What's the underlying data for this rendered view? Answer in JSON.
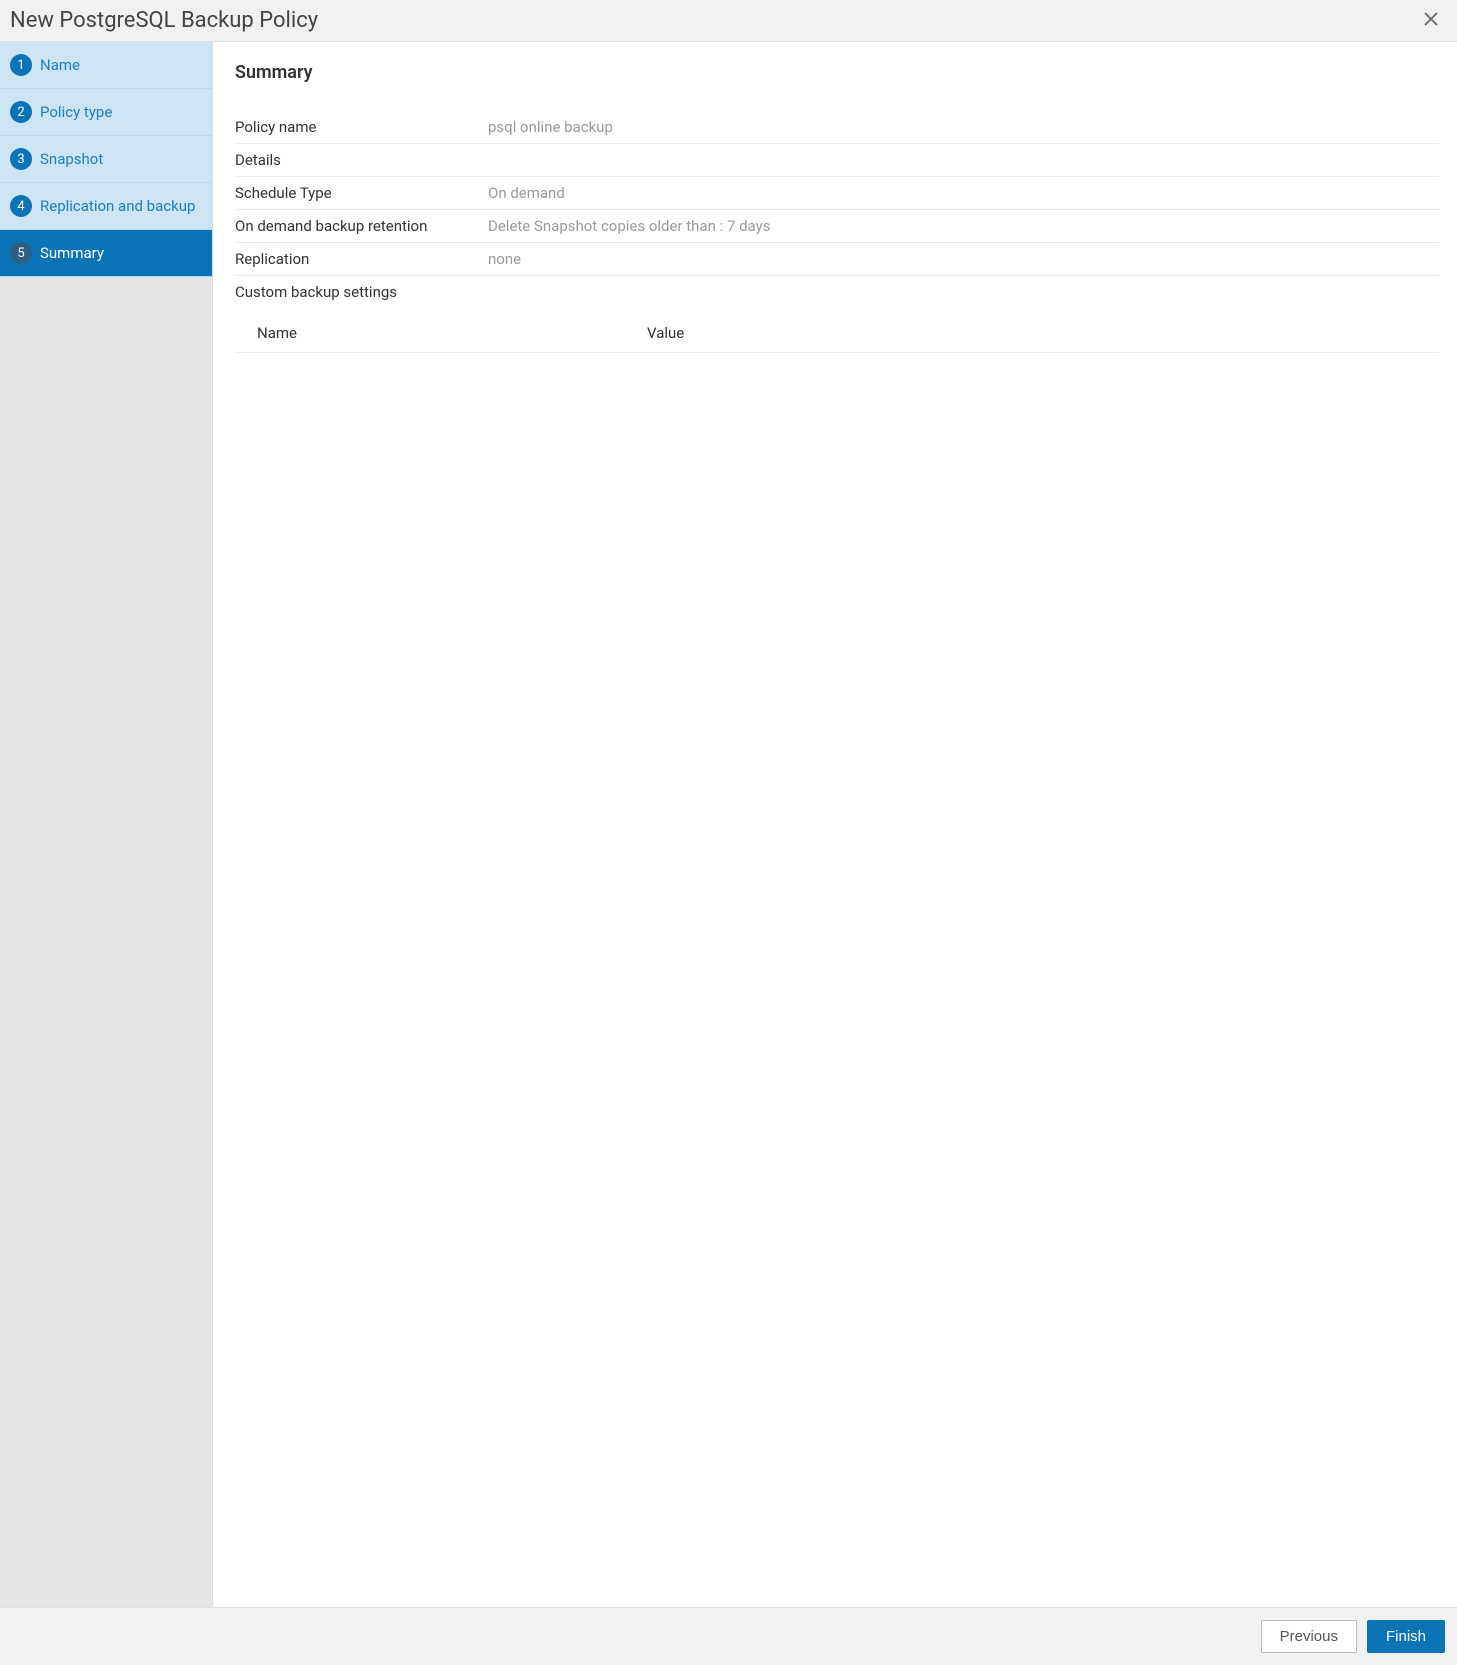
{
  "header": {
    "title": "New PostgreSQL Backup Policy"
  },
  "sidebar": {
    "steps": [
      {
        "num": "1",
        "label": "Name"
      },
      {
        "num": "2",
        "label": "Policy type"
      },
      {
        "num": "3",
        "label": "Snapshot"
      },
      {
        "num": "4",
        "label": "Replication and backup"
      },
      {
        "num": "5",
        "label": "Summary"
      }
    ]
  },
  "content": {
    "heading": "Summary",
    "rows": {
      "policy_name_label": "Policy name",
      "policy_name_value": "psql online backup",
      "details_label": "Details",
      "schedule_type_label": "Schedule Type",
      "schedule_type_value": "On demand",
      "retention_label": "On demand backup retention",
      "retention_value": "Delete Snapshot copies older than : 7 days",
      "replication_label": "Replication",
      "replication_value": "none",
      "custom_label": "Custom backup settings"
    },
    "custom_table": {
      "col_name": "Name",
      "col_value": "Value",
      "rows": []
    }
  },
  "footer": {
    "previous": "Previous",
    "finish": "Finish"
  }
}
